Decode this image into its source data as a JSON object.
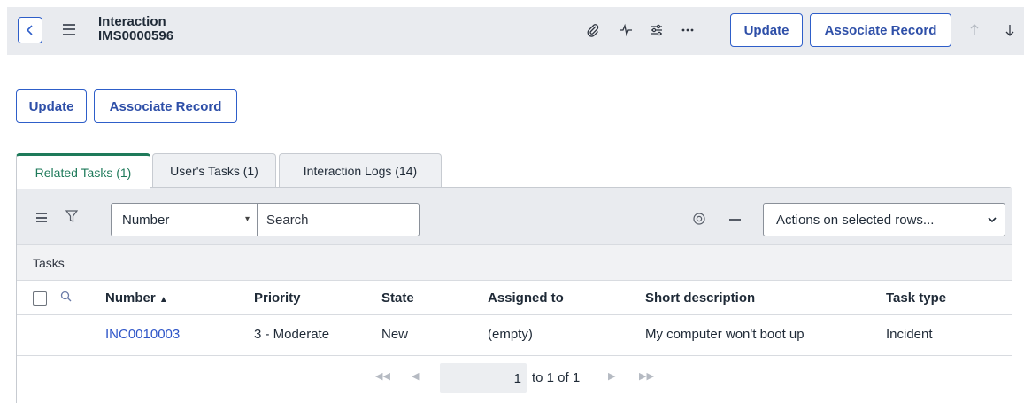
{
  "header": {
    "title": "Interaction",
    "record_number": "IMS0000596",
    "update_label": "Update",
    "associate_label": "Associate Record",
    "icons": [
      "back-chevron-icon",
      "hamburger-icon",
      "paperclip-icon",
      "activity-icon",
      "settings-sliders-icon",
      "more-icon",
      "arrow-up-icon",
      "arrow-down-icon"
    ]
  },
  "form": {
    "update_label": "Update",
    "associate_label": "Associate Record"
  },
  "tabs": [
    {
      "label": "Related Tasks (1)",
      "active": true
    },
    {
      "label": "User's Tasks (1)",
      "active": false
    },
    {
      "label": "Interaction Logs (14)",
      "active": false
    }
  ],
  "list": {
    "field_select": "Number",
    "search_placeholder": "Search",
    "actions_select": "Actions on selected rows...",
    "table_label": "Tasks",
    "columns": [
      "Number",
      "Priority",
      "State",
      "Assigned to",
      "Short description",
      "Task type"
    ],
    "sort_indicator": "▲",
    "rows": [
      {
        "number": "INC0010003",
        "priority": "3 - Moderate",
        "state": "New",
        "assigned_to": "(empty)",
        "short_description": "My computer won't boot up",
        "task_type": "Incident"
      }
    ],
    "pagination": {
      "page": "1",
      "range_text": "to 1 of 1"
    }
  },
  "colors": {
    "accent": "#2e5ec9",
    "active_tab": "#1e7a5a",
    "link": "#2e55c8",
    "header_bg": "#e9ebef"
  }
}
